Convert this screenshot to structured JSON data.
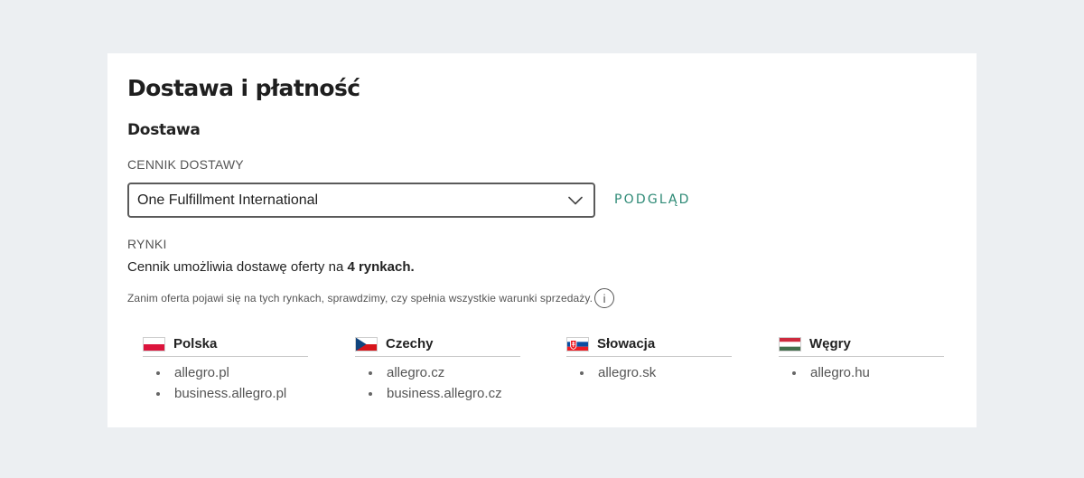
{
  "page": {
    "title": "Dostawa i płatność"
  },
  "delivery": {
    "section_title": "Dostawa",
    "pricelist_label": "CENNIK DOSTAWY",
    "pricelist_value": "One Fulfillment International",
    "preview_label": "PODGLĄD",
    "markets_label": "RYNKI",
    "markets_summary_prefix": "Cennik umożliwia dostawę oferty na ",
    "markets_summary_bold": "4 rynkach.",
    "note": "Zanim oferta pojawi się na tych rynkach, sprawdzimy, czy spełnia wszystkie warunki sprzedaży.",
    "info_icon_glyph": "i"
  },
  "markets": [
    {
      "name": "Polska",
      "flag": "poland-flag",
      "domains": [
        "allegro.pl",
        "business.allegro.pl"
      ]
    },
    {
      "name": "Czechy",
      "flag": "czech-flag",
      "domains": [
        "allegro.cz",
        "business.allegro.cz"
      ]
    },
    {
      "name": "Słowacja",
      "flag": "slovakia-flag",
      "domains": [
        "allegro.sk"
      ]
    },
    {
      "name": "Węgry",
      "flag": "hungary-flag",
      "domains": [
        "allegro.hu"
      ]
    }
  ],
  "colors": {
    "accent": "#2e8a76",
    "background": "#eceff2",
    "card": "#ffffff"
  }
}
